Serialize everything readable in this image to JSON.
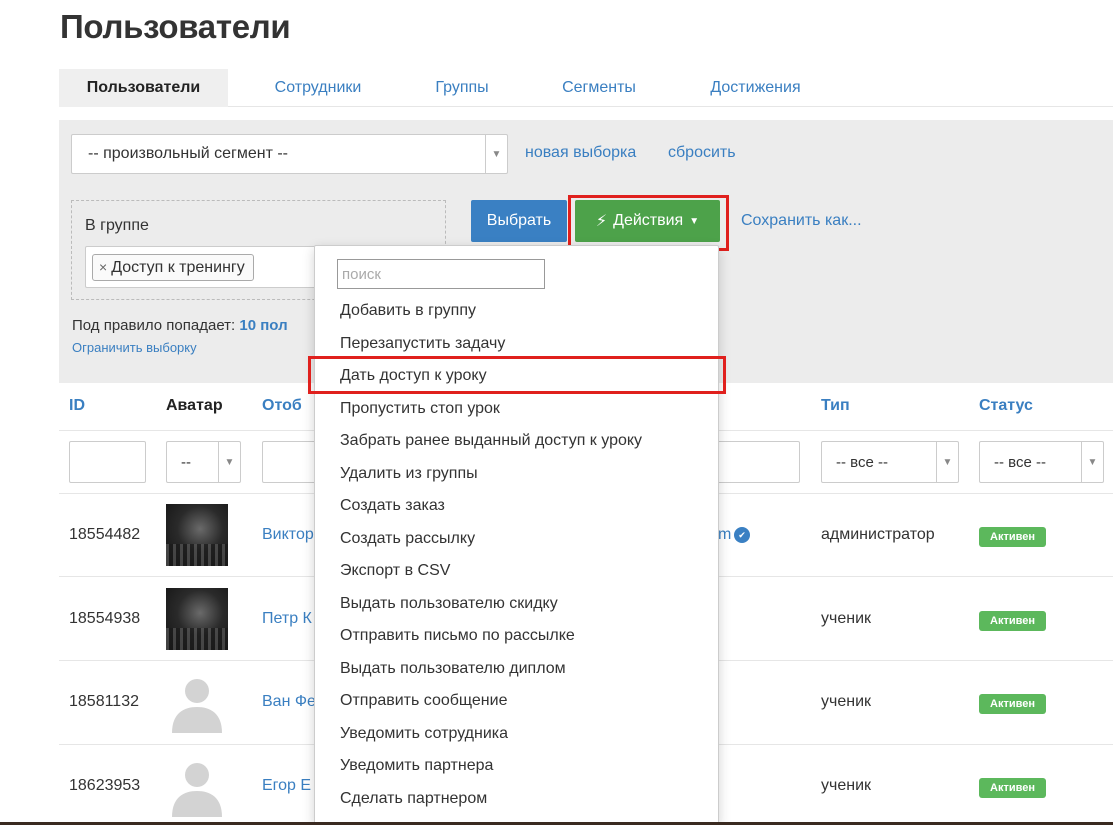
{
  "page_title": "Пользователи",
  "tabs": [
    {
      "label": "Пользователи",
      "active": true
    },
    {
      "label": "Сотрудники"
    },
    {
      "label": "Группы"
    },
    {
      "label": "Сегменты"
    },
    {
      "label": "Достижения"
    }
  ],
  "filter": {
    "segment_value": "-- произвольный сегмент --",
    "new_selection": "новая выборка",
    "reset": "сбросить",
    "group_label": "В группе",
    "tag_remove": "×",
    "tag": "Доступ к тренингу",
    "rule_prefix": "Под правило попадает:",
    "rule_count": "10 пол",
    "limit_link": "Ограничить выборку",
    "select_button": "Выбрать",
    "actions_icon": "lightning-icon",
    "actions_button": "Действия",
    "save_as": "Сохранить как..."
  },
  "columns": {
    "id": "ID",
    "avatar": "Аватар",
    "display_name": "Отоб",
    "type": "Тип",
    "status": "Статус"
  },
  "column_filters": {
    "avatar_value": "--",
    "type_value": "-- все --",
    "status_value": "-- все --"
  },
  "rows": [
    {
      "id": "18554482",
      "name": "Виктор",
      "email_tail": "m",
      "verified": true,
      "type": "администратор",
      "status": "Активен",
      "avatar": "photo"
    },
    {
      "id": "18554938",
      "name": "Петр К",
      "type": "ученик",
      "status": "Активен",
      "avatar": "photo"
    },
    {
      "id": "18581132",
      "name": "Ван Фе",
      "type": "ученик",
      "status": "Активен",
      "avatar": "placeholder"
    },
    {
      "id": "18623953",
      "name": "Егор Е",
      "type": "ученик",
      "status": "Активен",
      "avatar": "placeholder"
    }
  ],
  "dropdown": {
    "search_placeholder": "поиск",
    "items": [
      "Добавить в группу",
      "Перезапустить задачу",
      "Дать доступ к уроку",
      "Пропустить стоп урок",
      "Забрать ранее выданный доступ к уроку",
      "Удалить из группы",
      "Создать заказ",
      "Создать рассылку",
      "Экспорт в CSV",
      "Выдать пользователю скидку",
      "Отправить письмо по рассылке",
      "Выдать пользователю диплом",
      "Отправить сообщение",
      "Уведомить сотрудника",
      "Уведомить партнера",
      "Сделать партнером"
    ],
    "highlighted_item": "Дать доступ к уроку"
  },
  "colors": {
    "link": "#3a7fc1",
    "primary_button": "#3a80c3",
    "actions_button": "#4da24a",
    "status_badge": "#5cb85c",
    "highlight": "#e0201d"
  }
}
